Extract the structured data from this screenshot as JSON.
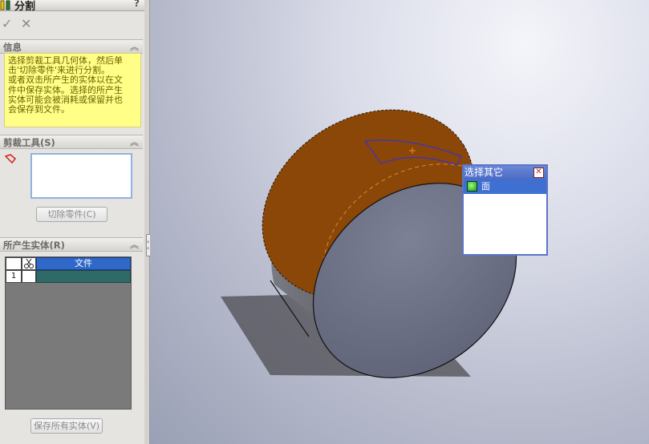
{
  "feature": {
    "title": "分割",
    "help": "?",
    "ok_icon": "✓",
    "cancel_icon": "✕"
  },
  "sections": {
    "info": {
      "header": "信息",
      "lines": [
        "选择剪裁工具几何体，然后单",
        "击'切除零件'来进行分割。",
        "或者双击所产生的实体以在文",
        "件中保存实体。选择的所产生",
        "实体可能会被消耗或保留并也",
        "会保存到文件。"
      ]
    },
    "trim_tools": {
      "header": "剪裁工具(S)",
      "cut_part_button": "切除零件(C)"
    },
    "resulting_bodies": {
      "header": "所产生实体(R)",
      "column_file": "文件",
      "rows": [
        {
          "index": "1",
          "file": ""
        }
      ],
      "save_all_button": "保存所有实体(V)"
    }
  },
  "select_other": {
    "title": "选择其它",
    "close_icon": "✕",
    "items": [
      {
        "label": "面",
        "icon": "face-icon"
      }
    ]
  },
  "colors": {
    "panel_bg": "#e6e4e0",
    "info_bg": "#ffff88",
    "info_text": "#6d6300",
    "selected_face": "#8b4707",
    "cylinder_face": "#6d7285",
    "popup_title": "#4b6bc4"
  }
}
